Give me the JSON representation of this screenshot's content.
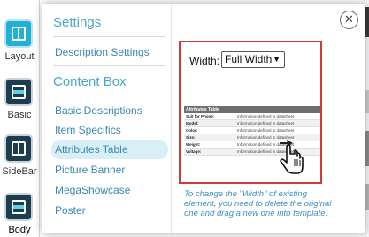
{
  "left_panel": {
    "buttons": [
      {
        "label": "Layout",
        "icon": "layout-icon"
      },
      {
        "label": "Basic",
        "icon": "basic-icon"
      },
      {
        "label": "SideBar",
        "icon": "sidebar-icon"
      },
      {
        "label": "Body",
        "icon": "body-icon"
      }
    ]
  },
  "menu": {
    "settings_title": "Settings",
    "settings_items": [
      "Description Settings"
    ],
    "content_title": "Content Box",
    "content_items": [
      "Basic Descriptions",
      "Item Specifics",
      "Attributes Table",
      "Picture Banner",
      "MegaShowcase",
      "Poster"
    ],
    "active_item": "Attributes Table"
  },
  "preview": {
    "width_label": "Width:",
    "width_value": "Full Width",
    "table": {
      "title": "Attributes Table",
      "rows": [
        {
          "key": "Suit for Phone:",
          "value": "Information defined in datasheet"
        },
        {
          "key": "Model:",
          "value": "Information defined in datasheet"
        },
        {
          "key": "Color:",
          "value": "Information defined in datasheet"
        },
        {
          "key": "Size:",
          "value": "Information defined in datasheet"
        },
        {
          "key": "Weight:",
          "value": "Information defined in datasheet"
        },
        {
          "key": "Voltage:",
          "value": "Information defined in datasheet"
        }
      ]
    },
    "note": "To change the \"Width\" of existing element, you need to delete the original one and drag a new one into template."
  },
  "close_icon": "close-icon",
  "colors": {
    "accent": "#4aa7c9",
    "active_bg": "#d9eff7",
    "frame_border": "#d23a3a",
    "note_text": "#3b8fc0"
  }
}
